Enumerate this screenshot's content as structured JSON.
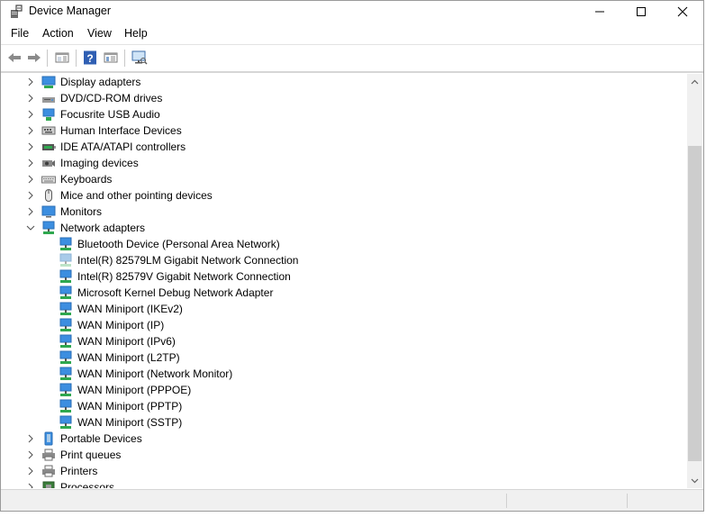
{
  "window": {
    "title": "Device Manager",
    "app_icon": "device-manager-icon"
  },
  "title_buttons": {
    "minimize": "minimize-icon",
    "maximize": "maximize-icon",
    "close": "close-icon"
  },
  "menu": [
    "File",
    "Action",
    "View",
    "Help"
  ],
  "toolbar": [
    "back-icon",
    "forward-icon",
    "properties-pane-icon",
    "help-icon",
    "show-hide-icon",
    "monitor-scan-icon"
  ],
  "tree": [
    {
      "label": "Display adapters",
      "level": 0,
      "expander": "collapsed",
      "icon": "display-adapter-icon"
    },
    {
      "label": "DVD/CD-ROM drives",
      "level": 0,
      "expander": "collapsed",
      "icon": "dvd-drive-icon"
    },
    {
      "label": "Focusrite USB Audio",
      "level": 0,
      "expander": "collapsed",
      "icon": "audio-device-icon"
    },
    {
      "label": "Human Interface Devices",
      "level": 0,
      "expander": "collapsed",
      "icon": "hid-icon"
    },
    {
      "label": "IDE ATA/ATAPI controllers",
      "level": 0,
      "expander": "collapsed",
      "icon": "ide-controller-icon"
    },
    {
      "label": "Imaging devices",
      "level": 0,
      "expander": "collapsed",
      "icon": "camera-icon"
    },
    {
      "label": "Keyboards",
      "level": 0,
      "expander": "collapsed",
      "icon": "keyboard-icon"
    },
    {
      "label": "Mice and other pointing devices",
      "level": 0,
      "expander": "collapsed",
      "icon": "mouse-icon"
    },
    {
      "label": "Monitors",
      "level": 0,
      "expander": "collapsed",
      "icon": "monitor-icon"
    },
    {
      "label": "Network adapters",
      "level": 0,
      "expander": "expanded",
      "icon": "network-adapter-icon"
    },
    {
      "label": "Bluetooth Device (Personal Area Network)",
      "level": 1,
      "icon": "network-adapter-icon"
    },
    {
      "label": "Intel(R) 82579LM Gigabit Network Connection",
      "level": 1,
      "icon": "network-adapter-disabled-icon"
    },
    {
      "label": "Intel(R) 82579V Gigabit Network Connection",
      "level": 1,
      "icon": "network-adapter-icon"
    },
    {
      "label": "Microsoft Kernel Debug Network Adapter",
      "level": 1,
      "icon": "network-adapter-icon"
    },
    {
      "label": "WAN Miniport (IKEv2)",
      "level": 1,
      "icon": "network-adapter-icon"
    },
    {
      "label": "WAN Miniport (IP)",
      "level": 1,
      "icon": "network-adapter-icon"
    },
    {
      "label": "WAN Miniport (IPv6)",
      "level": 1,
      "icon": "network-adapter-icon"
    },
    {
      "label": "WAN Miniport (L2TP)",
      "level": 1,
      "icon": "network-adapter-icon"
    },
    {
      "label": "WAN Miniport (Network Monitor)",
      "level": 1,
      "icon": "network-adapter-icon"
    },
    {
      "label": "WAN Miniport (PPPOE)",
      "level": 1,
      "icon": "network-adapter-icon"
    },
    {
      "label": "WAN Miniport (PPTP)",
      "level": 1,
      "icon": "network-adapter-icon"
    },
    {
      "label": "WAN Miniport (SSTP)",
      "level": 1,
      "icon": "network-adapter-icon"
    },
    {
      "label": "Portable Devices",
      "level": 0,
      "expander": "collapsed",
      "icon": "portable-device-icon"
    },
    {
      "label": "Print queues",
      "level": 0,
      "expander": "collapsed",
      "icon": "printer-icon"
    },
    {
      "label": "Printers",
      "level": 0,
      "expander": "collapsed",
      "icon": "printer-icon"
    },
    {
      "label": "Processors",
      "level": 0,
      "expander": "collapsed",
      "icon": "processor-icon"
    }
  ],
  "scrollbar": {
    "up": "scroll-up-icon",
    "down": "scroll-down-icon"
  },
  "colors": {
    "net_blue": "#3c8ee0",
    "net_green": "#2fa84f",
    "net_disabled": "#a9cbe9",
    "chevron": "#555555"
  }
}
